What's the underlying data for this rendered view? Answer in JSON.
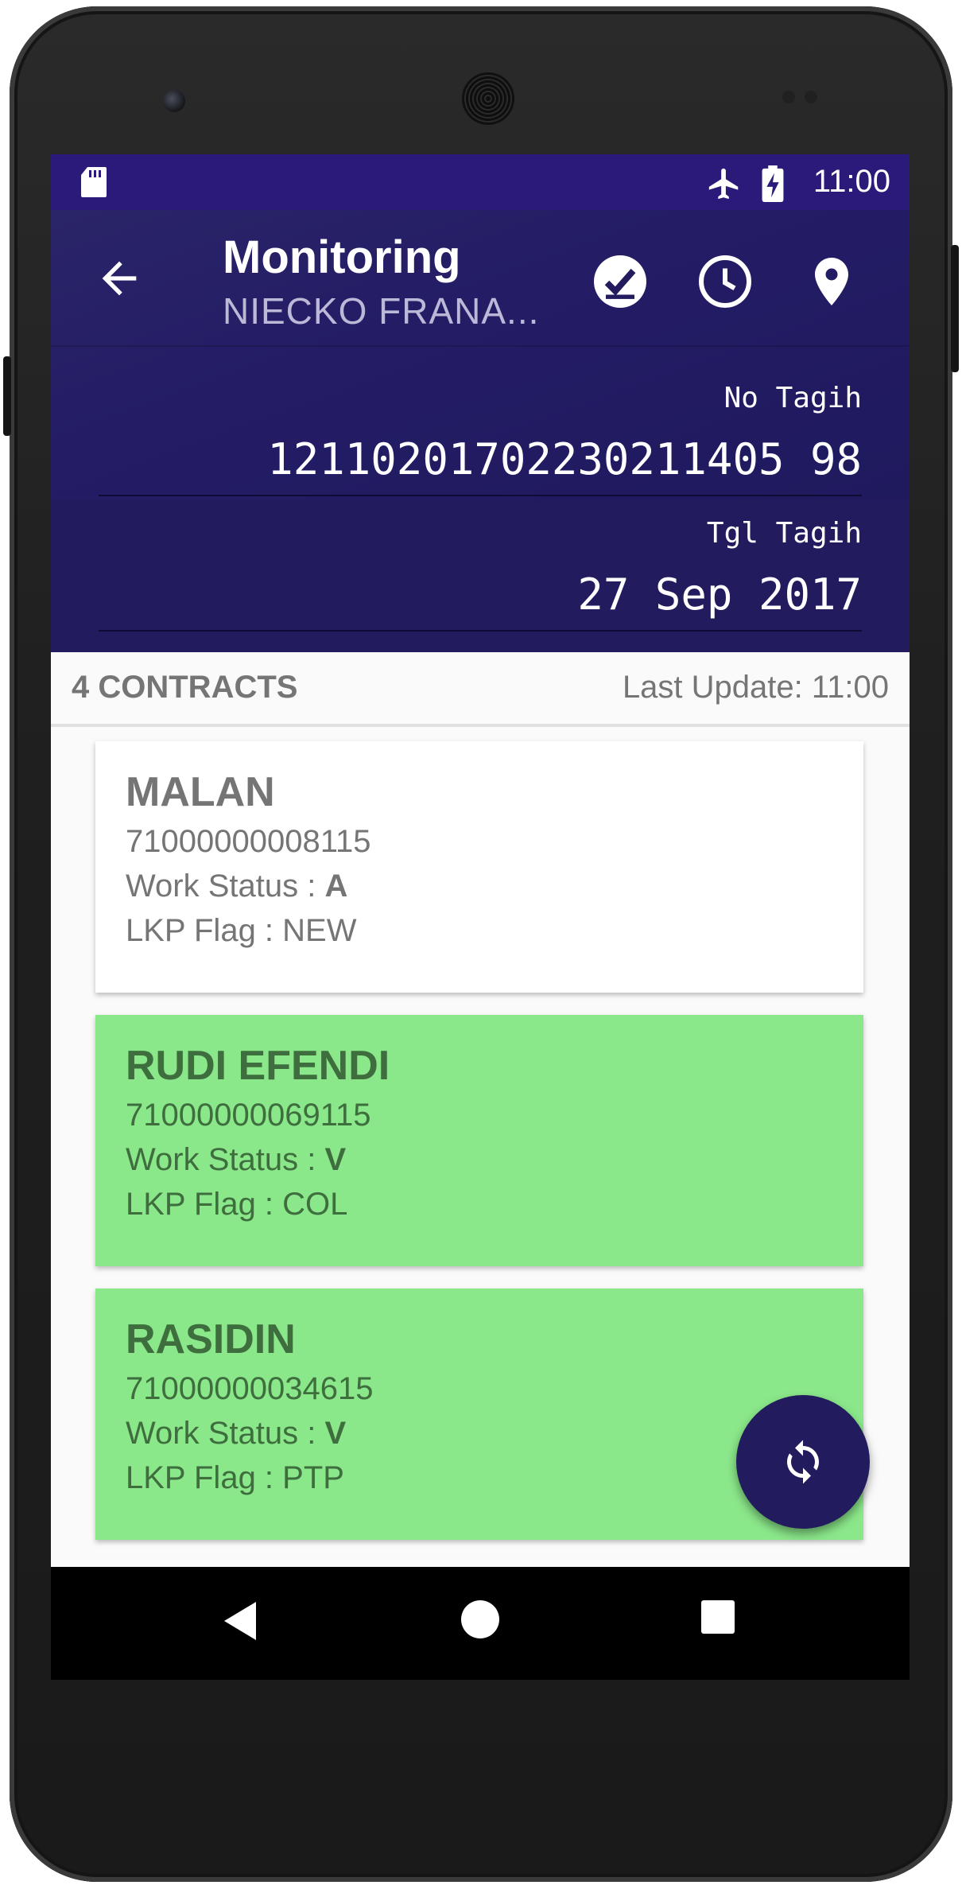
{
  "status_bar": {
    "time": "11:00",
    "icons": [
      "sd-card-icon",
      "airplane-icon",
      "battery-charging-icon"
    ]
  },
  "toolbar": {
    "title": "Monitoring",
    "subtitle": "NIECKO FRANA...",
    "actions": [
      "check-badge-icon",
      "clock-icon",
      "location-pin-icon"
    ]
  },
  "billing": {
    "no_tagih_label": "No Tagih",
    "no_tagih_value": "12110201702230211405 98",
    "tgl_tagih_label": "Tgl Tagih",
    "tgl_tagih_value": "27 Sep 2017"
  },
  "summary": {
    "count": "4 CONTRACTS",
    "last_update": "Last Update: 11:00"
  },
  "contracts": [
    {
      "name": "MALAN",
      "number": "71000000008115",
      "work_status_label": "Work Status : ",
      "work_status": "A",
      "flag": "LKP Flag : NEW",
      "color": "#ffffff"
    },
    {
      "name": "RUDI EFENDI",
      "number": "71000000069115",
      "work_status_label": "Work Status : ",
      "work_status": "V",
      "flag": "LKP Flag : COL",
      "color": "#8be88a"
    },
    {
      "name": "RASIDIN",
      "number": "71000000034615",
      "work_status_label": "Work Status : ",
      "work_status": "V",
      "flag": "LKP Flag : PTP",
      "color": "#8be88a"
    }
  ],
  "fab": {
    "icon": "refresh-sync-icon"
  },
  "nav": [
    "back-triangle-icon",
    "home-circle-icon",
    "recents-square-icon"
  ]
}
